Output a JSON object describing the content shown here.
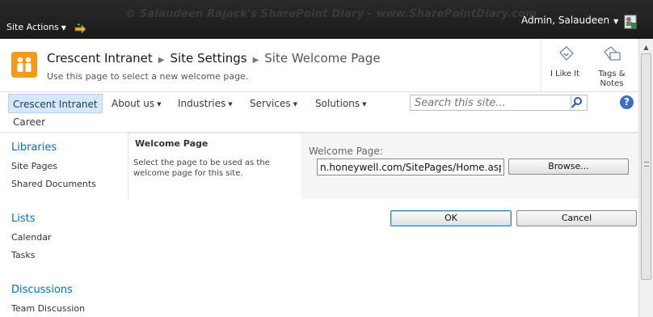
{
  "ribbon": {
    "watermark": "© Salaudeen Rajack's SharePoint Diary - www.SharePointDiary.com",
    "site_actions_label": "Site Actions",
    "user_name": "Admin, Salaudeen"
  },
  "title_area": {
    "breadcrumb": [
      "Crescent Intranet",
      "Site Settings",
      "Site Welcome Page"
    ],
    "description": "Use this page to select a new welcome page.",
    "i_like_it_label": "I Like It",
    "tags_label_line1": "Tags &",
    "tags_label_line2": "Notes"
  },
  "top_nav": {
    "items": [
      {
        "label": "Crescent Intranet",
        "has_menu": false,
        "selected": true
      },
      {
        "label": "About us",
        "has_menu": true
      },
      {
        "label": "Industries",
        "has_menu": true
      },
      {
        "label": "Services",
        "has_menu": true
      },
      {
        "label": "Solutions",
        "has_menu": true
      }
    ],
    "second_row": "Career",
    "search_placeholder": "Search this site...",
    "help_glyph": "?"
  },
  "left_nav": {
    "groups": [
      {
        "heading": "Libraries",
        "items": [
          "Site Pages",
          "Shared Documents"
        ]
      },
      {
        "heading": "Lists",
        "items": [
          "Calendar",
          "Tasks"
        ]
      },
      {
        "heading": "Discussions",
        "items": [
          "Team Discussion"
        ]
      }
    ]
  },
  "welcome_section": {
    "title": "Welcome Page",
    "description": "Select the page to be used as the welcome page for this site.",
    "field_label": "Welcome Page:",
    "field_value": "n.honeywell.com/SitePages/Home.aspx",
    "browse_label": "Browse..."
  },
  "actions": {
    "ok_label": "OK",
    "cancel_label": "Cancel"
  },
  "colors": {
    "ribbon_bg": "#1f1f1f",
    "link_blue": "#0072bc",
    "logo_orange": "#f29a1c",
    "selected_nav_bg": "#d6e8f8"
  }
}
